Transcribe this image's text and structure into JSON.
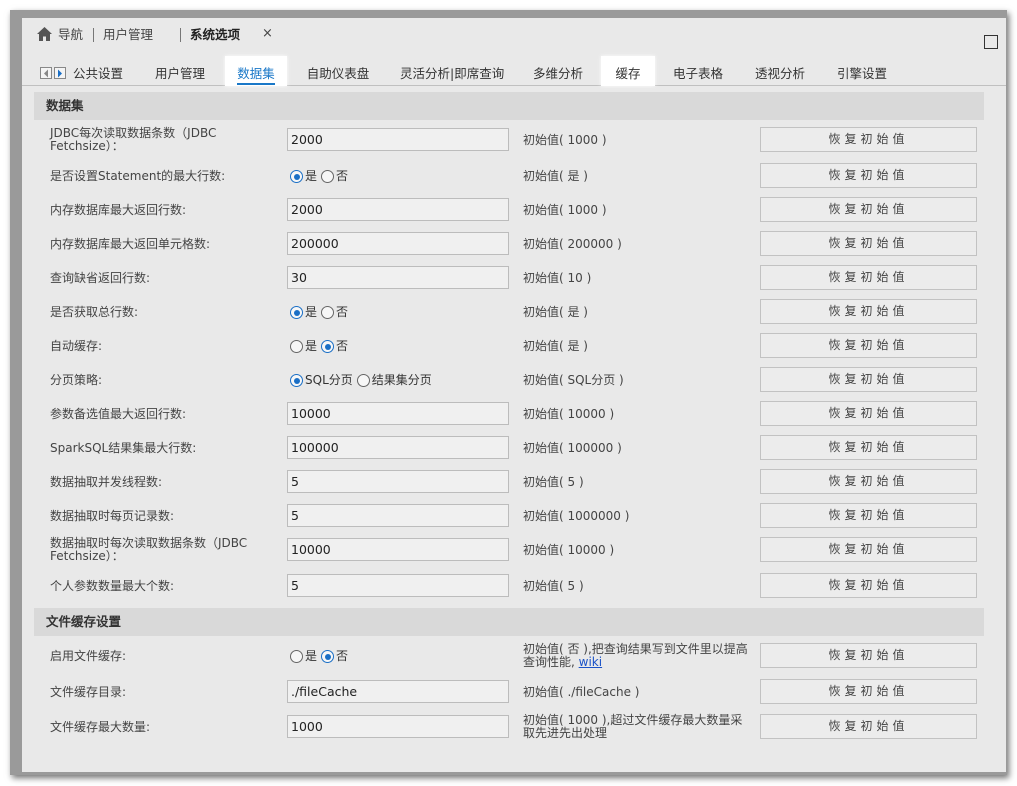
{
  "nav": {
    "home_label": "导航",
    "user_mgmt_label": "用户管理",
    "system_options_label": "系统选项",
    "close_symbol": "×"
  },
  "tabs": [
    {
      "label": "公共设置"
    },
    {
      "label": "用户管理"
    },
    {
      "label": "数据集"
    },
    {
      "label": "自助仪表盘"
    },
    {
      "label": "灵活分析|即席查询"
    },
    {
      "label": "多维分析"
    },
    {
      "label": "缓存"
    },
    {
      "label": "电子表格"
    },
    {
      "label": "透视分析"
    },
    {
      "label": "引擎设置"
    }
  ],
  "restore_label": "恢复初始值",
  "section_dataset": {
    "title": "数据集",
    "rows": [
      {
        "label": "JDBC每次读取数据条数（JDBC Fetchsize）：",
        "type": "input",
        "value": "2000",
        "init": "初始值( 1000 )"
      },
      {
        "label": "是否设置Statement的最大行数:",
        "type": "radio",
        "options": [
          "是",
          "否"
        ],
        "selected": 0,
        "init": "初始值( 是 )"
      },
      {
        "label": "内存数据库最大返回行数:",
        "type": "input",
        "value": "2000",
        "init": "初始值( 1000 )"
      },
      {
        "label": "内存数据库最大返回单元格数:",
        "type": "input",
        "value": "200000",
        "init": "初始值( 200000 )"
      },
      {
        "label": "查询缺省返回行数:",
        "type": "input",
        "value": "30",
        "init": "初始值( 10 )"
      },
      {
        "label": "是否获取总行数:",
        "type": "radio",
        "options": [
          "是",
          "否"
        ],
        "selected": 0,
        "init": "初始值( 是 )"
      },
      {
        "label": "自动缓存:",
        "type": "radio",
        "options": [
          "是",
          "否"
        ],
        "selected": 1,
        "init": "初始值( 是 )"
      },
      {
        "label": "分页策略:",
        "type": "radio",
        "options": [
          "SQL分页",
          "结果集分页"
        ],
        "selected": 0,
        "init": "初始值( SQL分页 )"
      },
      {
        "label": "参数备选值最大返回行数:",
        "type": "input",
        "value": "10000",
        "init": "初始值( 10000 )"
      },
      {
        "label": "SparkSQL结果集最大行数:",
        "type": "input",
        "value": "100000",
        "init": "初始值( 100000 )"
      },
      {
        "label": "数据抽取并发线程数:",
        "type": "input",
        "value": "5",
        "init": "初始值( 5 )"
      },
      {
        "label": "数据抽取时每页记录数:",
        "type": "input",
        "value": "5",
        "init": "初始值( 1000000 )"
      },
      {
        "label": "数据抽取时每次读取数据条数（JDBC Fetchsize）：",
        "type": "input",
        "value": "10000",
        "init": "初始值( 10000 )"
      },
      {
        "label": "个人参数数量最大个数:",
        "type": "input",
        "value": "5",
        "init": "初始值( 5 )"
      }
    ]
  },
  "section_filecache": {
    "title": "文件缓存设置",
    "rows": [
      {
        "label": "启用文件缓存:",
        "type": "radio",
        "options": [
          "是",
          "否"
        ],
        "selected": 1,
        "init": "初始值( 否 ),把查询结果写到文件里以提高查询性能,",
        "link": "wiki"
      },
      {
        "label": "文件缓存目录:",
        "type": "input",
        "value": "./fileCache",
        "init": "初始值( ./fileCache )"
      },
      {
        "label": "文件缓存最大数量:",
        "type": "input",
        "value": "1000",
        "init": "初始值( 1000 ),超过文件缓存最大数量采取先进先出处理"
      }
    ]
  }
}
